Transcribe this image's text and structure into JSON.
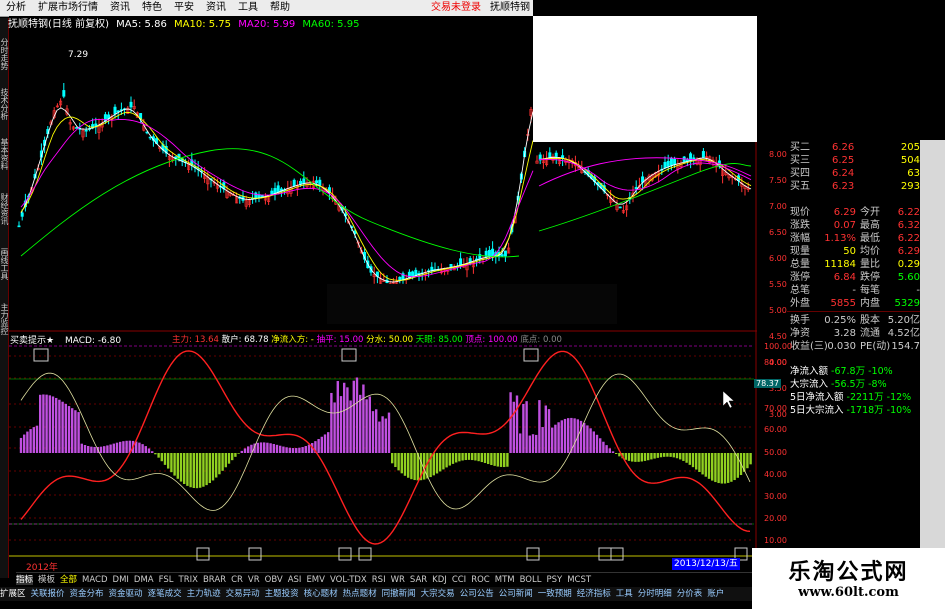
{
  "menu": {
    "items": [
      "分析",
      "扩展市场行情",
      "资讯",
      "特色",
      "平安",
      "资讯",
      "工具",
      "帮助"
    ],
    "right1": "交易未登录",
    "right2": "抚顺特钢"
  },
  "title": {
    "name": "抚顺特钢(日线 前复权)",
    "ma5": "MA5: 5.86",
    "ma10": "MA10: 5.75",
    "ma20": "MA20: 5.99",
    "ma60": "MA60: 5.95",
    "peak": "7.29"
  },
  "lefttabs": [
    "分时走势",
    "技术分析",
    "基本资料",
    "财经资讯",
    "画线工具",
    "主力监控"
  ],
  "indicator": {
    "name": "买卖提示★",
    "macd": "MACD: -6.80",
    "zl": "主力: 13.64",
    "sh": "散户: 68.78",
    "jl": "净流入方: -",
    "qp": "抽平: 15.00",
    "fs": "分水: 50.00",
    "tk": "天眼: 85.00",
    "kz": "顶点: 100.00",
    "dd": "底点: 0.00"
  },
  "indicator_axis": [
    "100.00",
    "80.00",
    "78.37",
    "70.00",
    "60.00",
    "50.00",
    "40.00",
    "30.00",
    "20.00",
    "10.00"
  ],
  "price_axis": [
    "8.00",
    "7.50",
    "7.00",
    "6.50",
    "6.00",
    "5.50",
    "5.00",
    "4.50",
    "4.00",
    "3.50",
    "3.00"
  ],
  "date_label": "2013/12/13/五",
  "year_label": "2012年",
  "quote": {
    "asks": [
      {
        "l": "买二",
        "p": "6.26",
        "v": "205"
      },
      {
        "l": "买三",
        "p": "6.25",
        "v": "504"
      },
      {
        "l": "买四",
        "p": "6.24",
        "v": "63"
      },
      {
        "l": "买五",
        "p": "6.23",
        "v": "293"
      }
    ],
    "stats": [
      {
        "a": "现价",
        "b": "6.29",
        "c": "今开",
        "d": "6.22"
      },
      {
        "a": "涨跌",
        "b": "0.07",
        "c": "最高",
        "d": "6.32"
      },
      {
        "a": "涨幅",
        "b": "1.13%",
        "c": "最低",
        "d": "6.22"
      },
      {
        "a": "现量",
        "b": "50",
        "c": "均价",
        "d": "6.29"
      },
      {
        "a": "总量",
        "b": "11184",
        "c": "量比",
        "d": "0.29"
      },
      {
        "a": "涨停",
        "b": "6.84",
        "c": "跌停",
        "d": "5.60"
      },
      {
        "a": "总笔",
        "b": "-",
        "c": "每笔",
        "d": "-"
      },
      {
        "a": "外盘",
        "b": "5855",
        "c": "内盘",
        "d": "5329"
      },
      {
        "a": "换手",
        "b": "0.25%",
        "c": "股本",
        "d": "5.20亿"
      },
      {
        "a": "净资",
        "b": "3.28",
        "c": "流通",
        "d": "4.52亿"
      },
      {
        "a": "收益(三)",
        "b": "0.030",
        "c": "PE(动)",
        "d": "154.7"
      }
    ],
    "flows": [
      {
        "l": "净流入额",
        "v": "-67.8万",
        "p": "-10%"
      },
      {
        "l": "大宗流入",
        "v": "-56.5万",
        "p": "-8%"
      },
      {
        "l": "5日净流入额",
        "v": "-2211万",
        "p": "-12%"
      },
      {
        "l": "5日大宗流入",
        "v": "-1718万",
        "p": "-10%"
      }
    ]
  },
  "formula_bar": [
    "指标",
    "模板",
    "全部",
    "MACD",
    "DMI",
    "DMA",
    "FSL",
    "TRIX",
    "BRAR",
    "CR",
    "VR",
    "OBV",
    "ASI",
    "EMV",
    "VOL-TDX",
    "RSI",
    "WR",
    "SAR",
    "KDJ",
    "CCI",
    "ROC",
    "MTM",
    "BOLL",
    "PSY",
    "MCST"
  ],
  "tab_bar": [
    "扩展区",
    "关联报价",
    "资金分布",
    "资金驱动",
    "逐笔成交",
    "主力轨迹",
    "交易异动",
    "主题投资",
    "核心题材",
    "热点题材",
    "同撤新闻",
    "大宗交易",
    "公司公告",
    "公司新闻",
    "一致预期",
    "经济指标",
    "工具",
    "分时明细",
    "分价表",
    "账户"
  ],
  "watermark": {
    "cn": "乐淘公式网",
    "url": "www.60lt.com"
  },
  "colors": {
    "up": "#ff3232",
    "down": "#00ffff",
    "ma5": "#ffffff",
    "ma10": "#ffff00",
    "ma20": "#ff00ff",
    "ma60": "#00ff00",
    "accent": "#ff3232"
  }
}
